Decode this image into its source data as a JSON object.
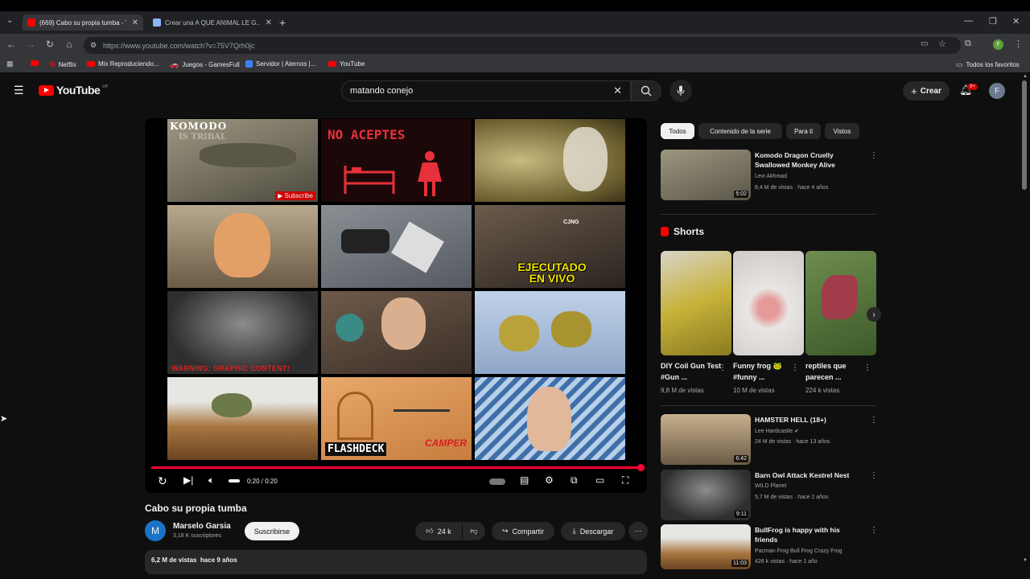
{
  "browser": {
    "tabs": [
      {
        "label": "(669) Cabo su propia tumba - YouTube",
        "active": true
      },
      {
        "label": "Crear una A QUE ANIMAL LE G...",
        "active": false
      }
    ],
    "url": "https://www.youtube.com/watch?v=75V7Qrh0jc",
    "bookmarks": [
      "Netflix",
      "Mix Reproduciendo...",
      "Juegos - GamesFull",
      "Servidor | Aternos |...",
      "YouTube"
    ],
    "all_bookmarks": "Todos los favoritos",
    "profile_initial": "F"
  },
  "header": {
    "logo_text": "YouTube",
    "logo_country": "UY",
    "search_value": "matando conejo",
    "create_label": "Crear",
    "notification_count": "9+",
    "avatar_initial": "F"
  },
  "player": {
    "thumb_texts": {
      "komodo": "KOMODO",
      "komodo_sub": "IS TRIBAL",
      "subscribe": "Subscribe",
      "no_aceptes": "NO ACEPTES",
      "ejecutado": "EJECUTADO EN VIVO",
      "warning": "WARNING: GRAPHIC CONTENT!",
      "flashdeck": "FLASHDECK",
      "camper": "CAMPER",
      "cjng": "CJNG"
    },
    "time": "0:20 / 0:20",
    "progress": 1.0
  },
  "video": {
    "title": "Cabo su propia tumba",
    "channel": "Marselo Garsia",
    "channel_initial": "M",
    "subscribers": "3,18 K suscriptores",
    "subscribe_label": "Suscribirse",
    "likes": "24 k",
    "share_label": "Compartir",
    "download_label": "Descargar",
    "views_date": "6,2 M de vistas  hace 9 años"
  },
  "sidebar": {
    "chips": [
      "Todos",
      "Contenido de la serie",
      "Para ti",
      "Vistos"
    ],
    "recs_top": [
      {
        "title": "Komodo Dragon Cruelly Swallowed Monkey Alive",
        "channel": "Levi Akhmad",
        "meta": "8,4 M de vistas · hace 4 años",
        "duration": "5:02",
        "color": "#8a8576"
      }
    ],
    "shorts_title": "Shorts",
    "shorts": [
      {
        "title": "DIY Coil Gun Test #Gun ...",
        "views": "9,8 M de vistas",
        "color": "#c7b23a"
      },
      {
        "title": "Funny frog 🐸 #funny ...",
        "views": "10 M de vistas",
        "color": "#d8d5d3"
      },
      {
        "title": "reptiles que parecen ...",
        "views": "224 k vistas",
        "color": "#5b7d3f"
      }
    ],
    "recs_bottom": [
      {
        "title": "HAMSTER HELL (18+)",
        "channel": "Lee Hardcastle",
        "meta": "24 M de vistas · hace 13 años",
        "duration": "6:42",
        "color": "#b8956a"
      },
      {
        "title": "Barn Owl Attack Kestrel Nest",
        "channel": "WILD Planet",
        "meta": "5,7 M de vistas · hace 2 años",
        "duration": "9:11",
        "color": "#555"
      },
      {
        "title": "BullFrog is happy with his friends",
        "channel": "Pacman Frog Bull Frog Crazy Frog",
        "meta": "426 k vistas · hace 1 año",
        "duration": "11:03",
        "color": "#a88a62"
      }
    ]
  }
}
